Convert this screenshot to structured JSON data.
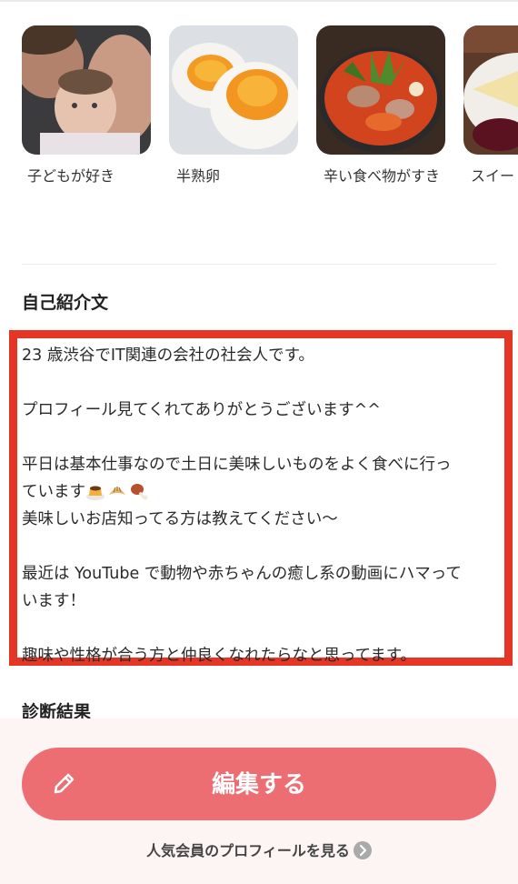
{
  "interests": [
    {
      "label": "子どもが好き",
      "image": "family-photo"
    },
    {
      "label": "半熟卵",
      "image": "boiled-egg-photo"
    },
    {
      "label": "辛い食べ物がすき",
      "image": "spicy-food-photo"
    },
    {
      "label": "スイー",
      "image": "sweets-photo"
    }
  ],
  "intro": {
    "title": "自己紹介文",
    "line1": "23 歳渋谷でIT関連の会社の社会人です。",
    "line2": "プロフィール見てくれてありがとうございます^^",
    "line3a": "平日は基本仕事なので土日に美味しいものをよく食べに行っ",
    "line3b": "ています",
    "line4": "美味しいお店知ってる方は教えてください〜",
    "line5a": "最近は YouTube で動物や赤ちゃんの癒し系の動画にハマって",
    "line5b": "います！",
    "line6": "趣味や性格が合う方と仲良くなれたらなと思ってます。",
    "emojis": [
      "pudding-emoji",
      "croissant-emoji",
      "meat-on-bone-emoji"
    ]
  },
  "diagnosis": {
    "title": "診断結果"
  },
  "actions": {
    "edit_label": "編集する",
    "popular_link": "人気会員のプロフィールを見る"
  },
  "colors": {
    "accent": "#ec6e72",
    "highlight": "#e53525"
  }
}
